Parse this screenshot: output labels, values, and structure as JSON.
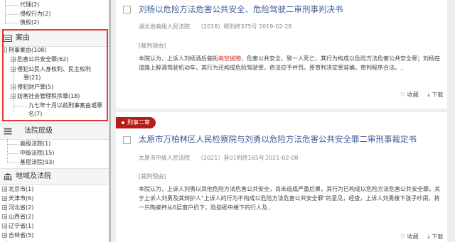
{
  "sidebar": {
    "top_items": [
      "代理(2)",
      "侵权行为(2)",
      "债权(2)"
    ],
    "case_section": {
      "title": "案由",
      "root": "刑事案由(108)",
      "children": [
        "危害公共安全罪(62)",
        "侵犯公民人身权利、民主权利",
        "罪(21)",
        "侵犯财产罪(5)",
        "妨害社会管理秩序罪(18)",
        "九七年十月以前刑事案由或罪",
        "名(7)"
      ]
    },
    "court_level": {
      "title": "法院层级",
      "items": [
        "高级法院(1)",
        "中级法院(15)",
        "基层法院(93)"
      ]
    },
    "region": {
      "title": "地域及法院",
      "items": [
        "北京市(1)",
        "天津市(6)",
        "河北省(2)",
        "山西省(2)",
        "辽宁省(1)",
        "吉林省(5)"
      ]
    }
  },
  "results": [
    {
      "title": "刘杨以危险方法危害公共安全、危险驾驶二审刑事判决书",
      "court": "湖北省高级人民法院",
      "case_no": "（2018）鄂刑终375号",
      "date": "2019-02-28",
      "section_label": "[裁判理由]",
      "text_pre": "本院认为，上诉人刘杨酒后临街",
      "text_hl": "高空抛物",
      "text_post": "，危害公共安全，致一人死亡，其行为构成以危险方法危害公共安全罪；刘杨在道路上醉酒驾驶机动车，其行为还构成危险驾驶罪，依法应予并罚。原审判决定罪准确，审判程序合法。..",
      "fav": "收藏",
      "download": "下载"
    },
    {
      "badge": "刑事二审",
      "title": "太原市万柏林区人民检察院与刘勇以危险方法危害公共安全罪二审刑事裁定书",
      "court": "太原市中级人民法院",
      "case_no": "（2021）晋01刑终165号",
      "date": "2021-02-08",
      "section_label": "[裁判理由]",
      "text": "本院认为，上诉人刘勇以其他危险方法危害公共安全，尚未造成严重后果，其行为已构成以危险方法危害公共安全罪。关于上诉人刘勇及其辩护人\"上诉人的行为不构成以危险方法危害公共安全罪\"的意见，经查，上诉人刘勇楼下孩子吵闹，将一只陶瓷杯从6层窗户扔下，险些砸中楼下的行人及..",
      "fav": "收藏",
      "download": "下载"
    }
  ],
  "colors": {
    "accent": "#b71c1c",
    "link": "#3c5a98",
    "highlight_box": "#e53935"
  }
}
